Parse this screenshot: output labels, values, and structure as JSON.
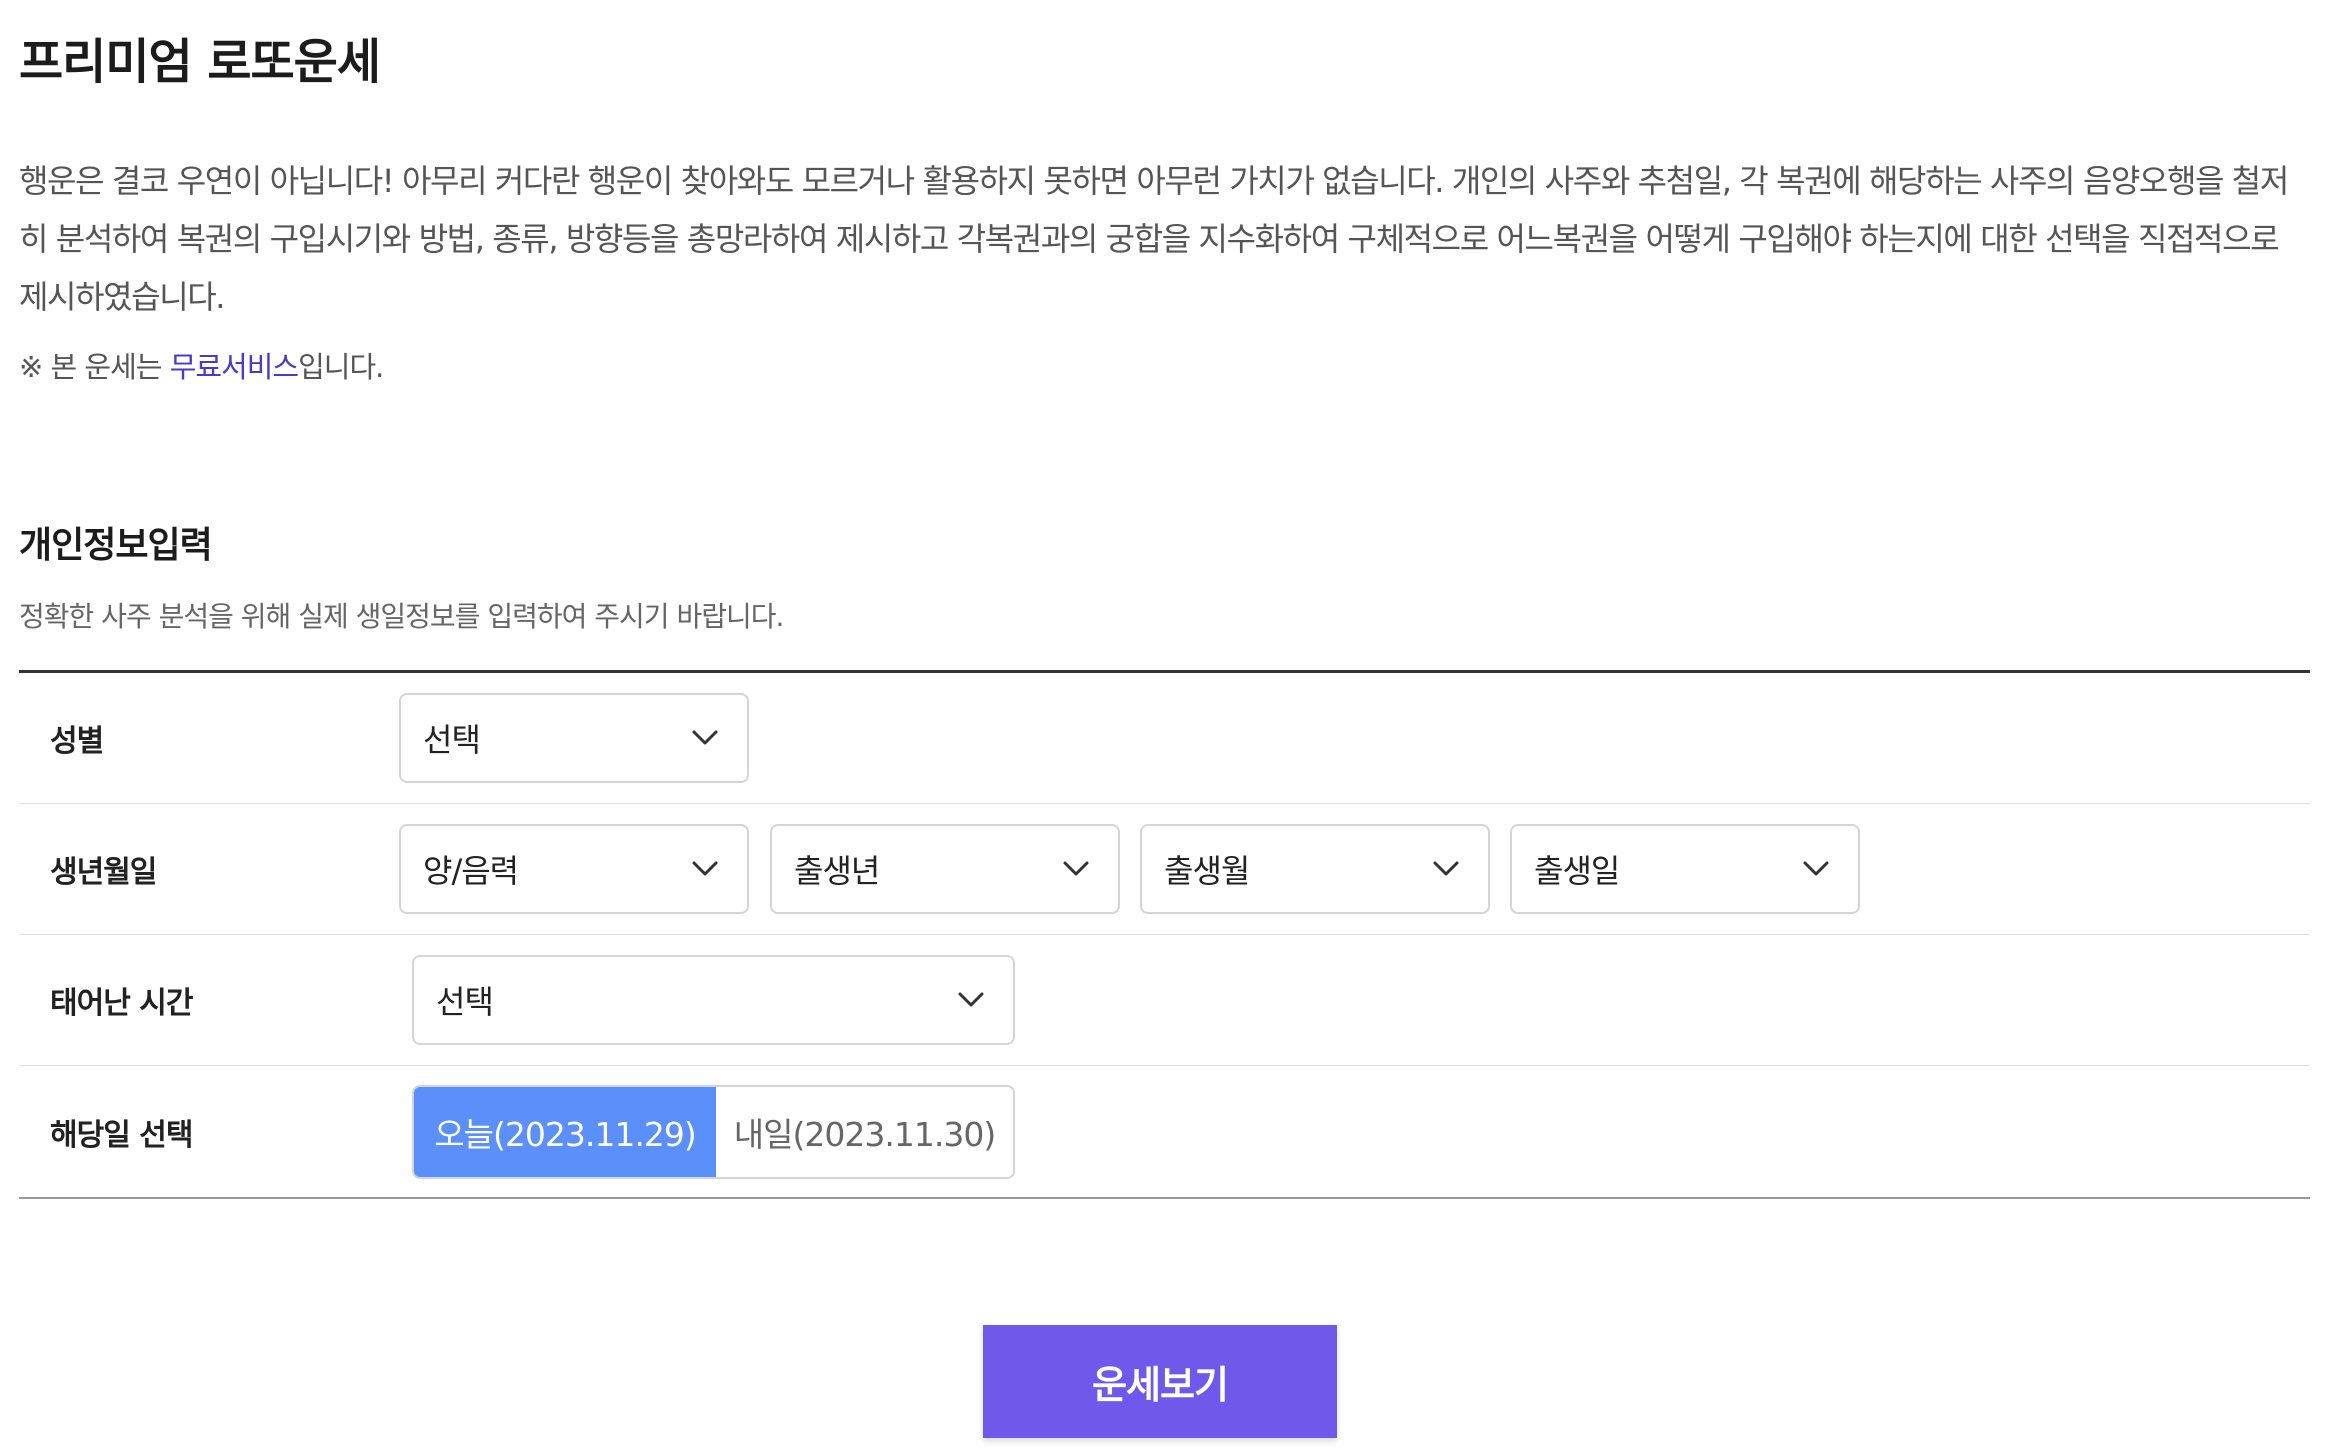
{
  "page": {
    "title": "프리미엄 로또운세",
    "description": "행운은 결코 우연이 아닙니다! 아무리 커다란 행운이 찾아와도 모르거나 활용하지 못하면 아무런 가치가 없습니다. 개인의 사주와 추첨일, 각 복권에 해당하는 사주의 음양오행을 철저히 분석하여 복권의 구입시기와 방법, 종류, 방향등을 총망라하여 제시하고 각복권과의 궁합을 지수화하여 구체적으로 어느복권을 어떻게 구입해야 하는지에 대한 선택을 직접적으로 제시하였습니다.",
    "notice_prefix": "※ 본 운세는 ",
    "notice_link": "무료서비스",
    "notice_suffix": "입니다."
  },
  "section": {
    "title": "개인정보입력",
    "subtitle": "정확한 사주 분석을 위해 실제 생일정보를 입력하여 주시기 바랍니다."
  },
  "form": {
    "gender": {
      "label": "성별",
      "value": "선택"
    },
    "birthdate": {
      "label": "생년월일",
      "calendar": "양/음력",
      "year": "출생년",
      "month": "출생월",
      "day": "출생일"
    },
    "birth_time": {
      "label": "태어난 시간",
      "value": "선택"
    },
    "target_day": {
      "label": "해당일 선택",
      "today": "오늘(2023.11.29)",
      "tomorrow": "내일(2023.11.30)",
      "selected": "today"
    }
  },
  "submit_label": "운세보기",
  "colors": {
    "accent": "#7058ea",
    "selected_day": "#5b8ff9",
    "link": "#4a3bc4"
  },
  "icons": {
    "dropdown": "chevron-down-icon"
  }
}
